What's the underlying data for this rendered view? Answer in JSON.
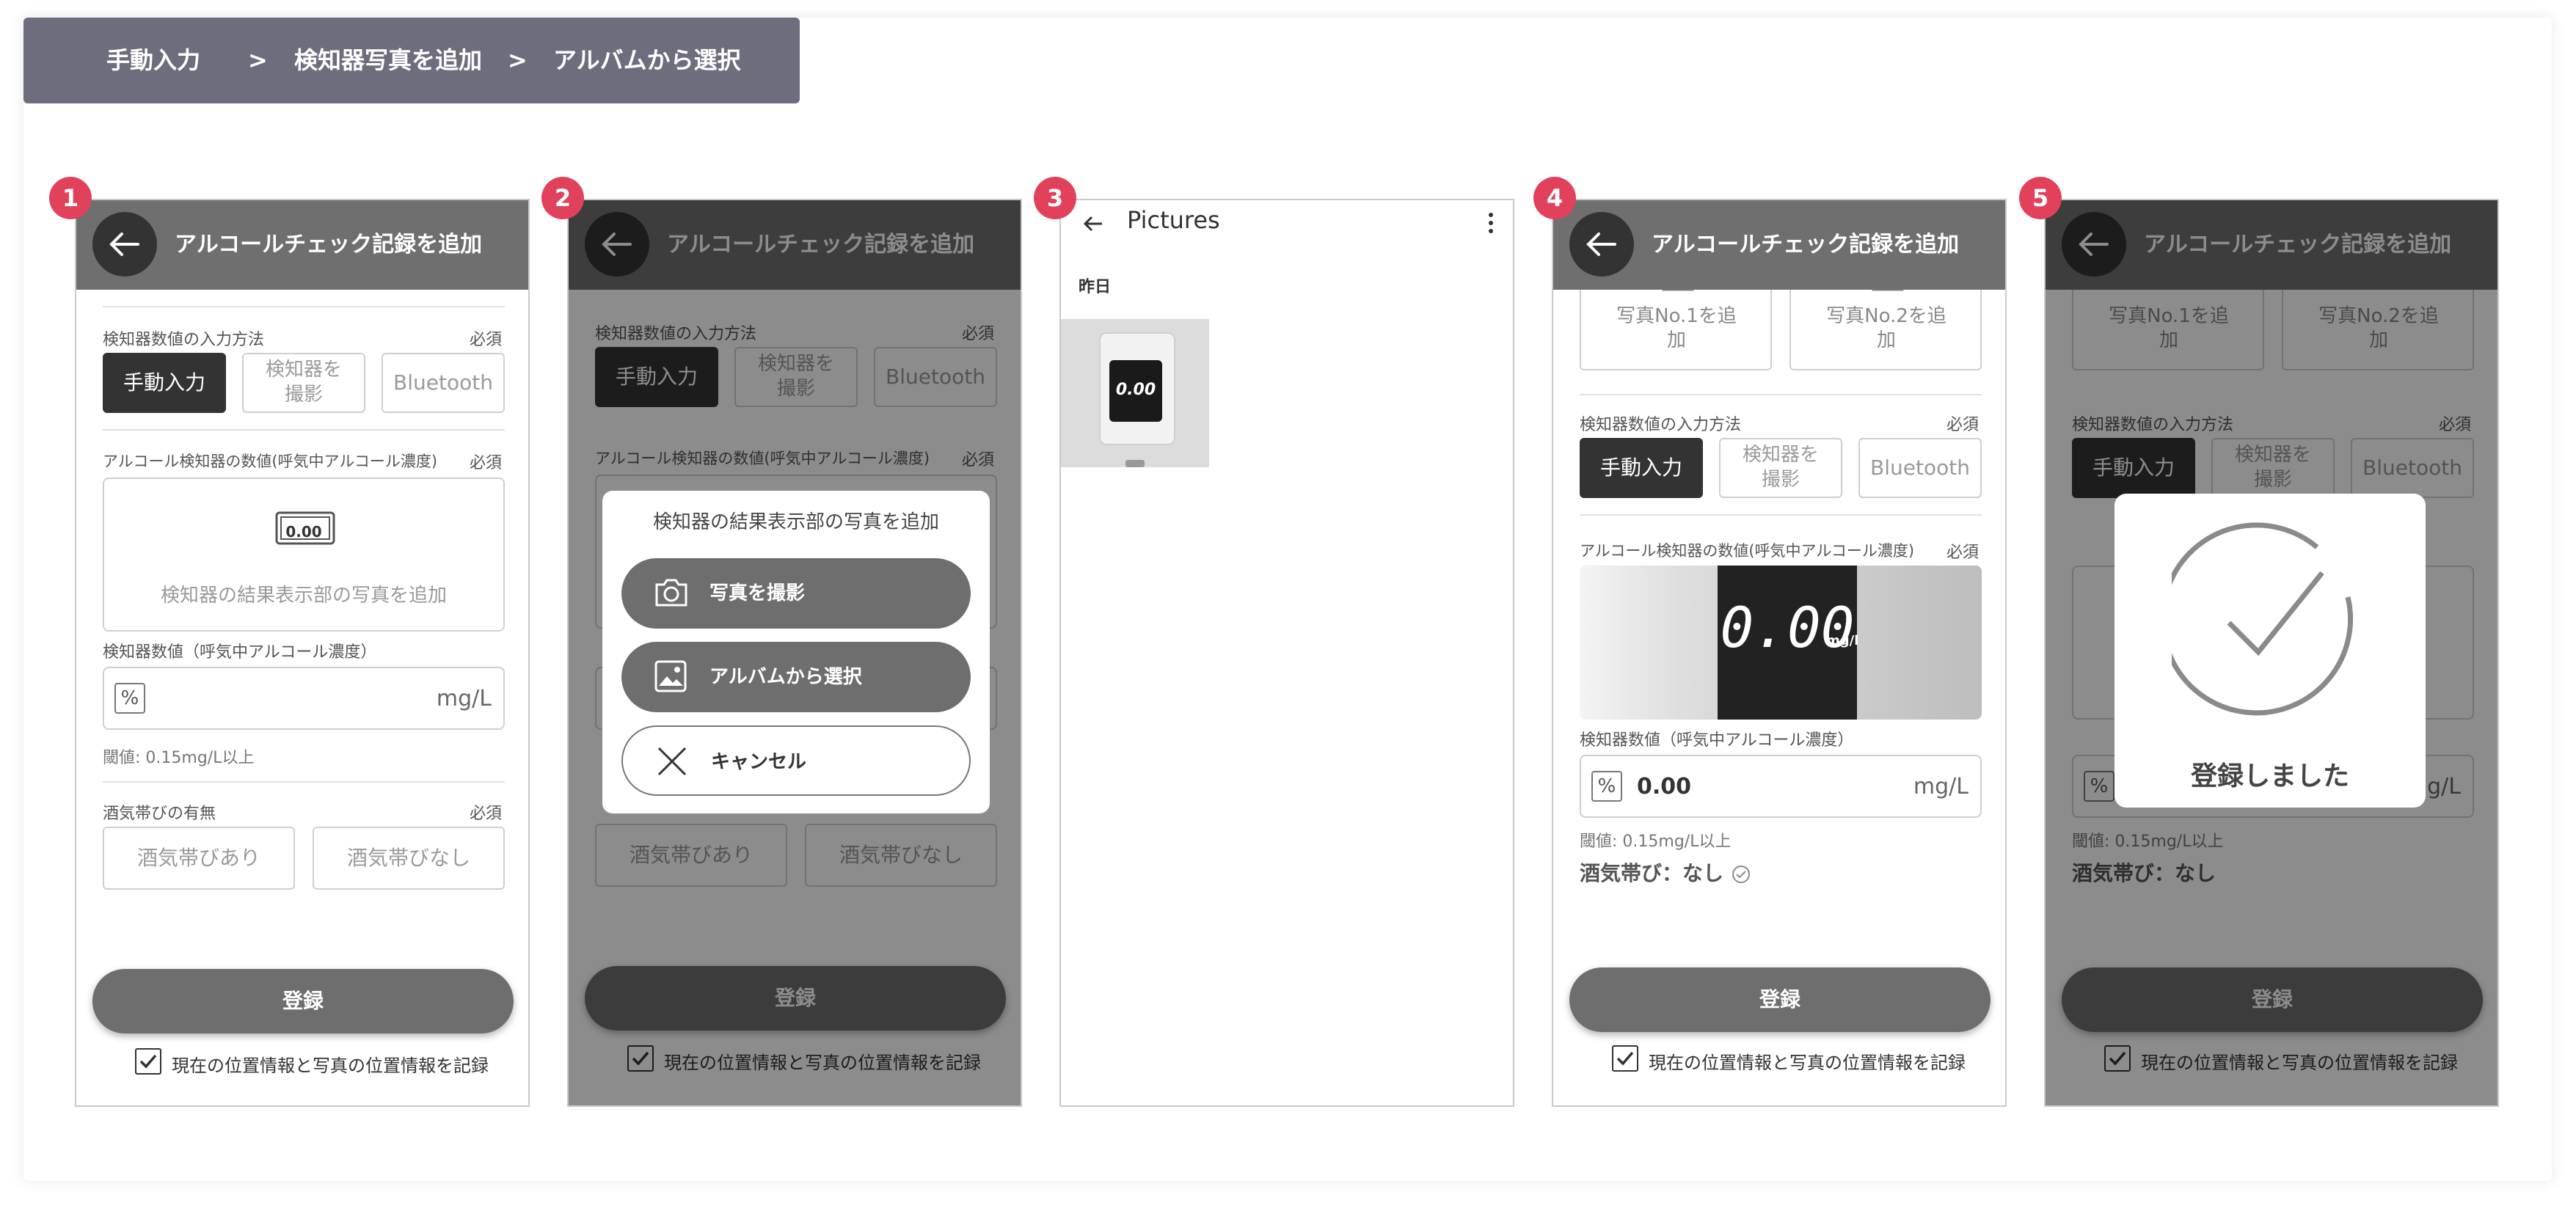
{
  "breadcrumb": {
    "step1": "手動入力",
    "sep": ">",
    "step2": "検知器写真を追加",
    "step3": "アルバムから選択"
  },
  "badges": [
    "1",
    "2",
    "3",
    "4",
    "5"
  ],
  "app": {
    "title": "アルコールチェック記録を追加",
    "input_method_label": "検知器数値の入力方法",
    "required": "必須",
    "manual": "手動入力",
    "camera": "検知器を撮影",
    "bluetooth": "Bluetooth",
    "alcohol_value_label": "アルコール検知器の数値(呼気中アルコール濃度)",
    "add_photo_text": "検知器の結果表示部の写真を追加",
    "placeholder_display": "0.00",
    "detector_value_label": "検知器数値（呼気中アルコール濃度）",
    "unit": "mg/L",
    "threshold": "閾値: 0.15mg/L以上",
    "drunk_label": "酒気帯びの有無",
    "drunk_yes": "酒気帯びあり",
    "drunk_no": "酒気帯びなし",
    "submit": "登録",
    "location_checkbox": "現在の位置情報と写真の位置情報を記録",
    "photo1": "写真No.1を追加",
    "photo2": "写真No.2を追加",
    "entered_value": "0.00",
    "drunk_result": "酒気帯び：なし",
    "photo_reading": "0.00",
    "photo_unit": "mg/l"
  },
  "sheet": {
    "title": "検知器の結果表示部の写真を追加",
    "take_photo": "写真を撮影",
    "from_album": "アルバムから選択",
    "cancel": "キャンセル"
  },
  "picker": {
    "title": "Pictures",
    "section": "昨日",
    "thumb_reading": "0.00"
  },
  "modal": {
    "message": "登録しました"
  },
  "colors": {
    "badge": "#e2415b",
    "header": "#6f6f6f",
    "breadcrumb": "#6d6d7e",
    "dark_button": "#333333"
  }
}
